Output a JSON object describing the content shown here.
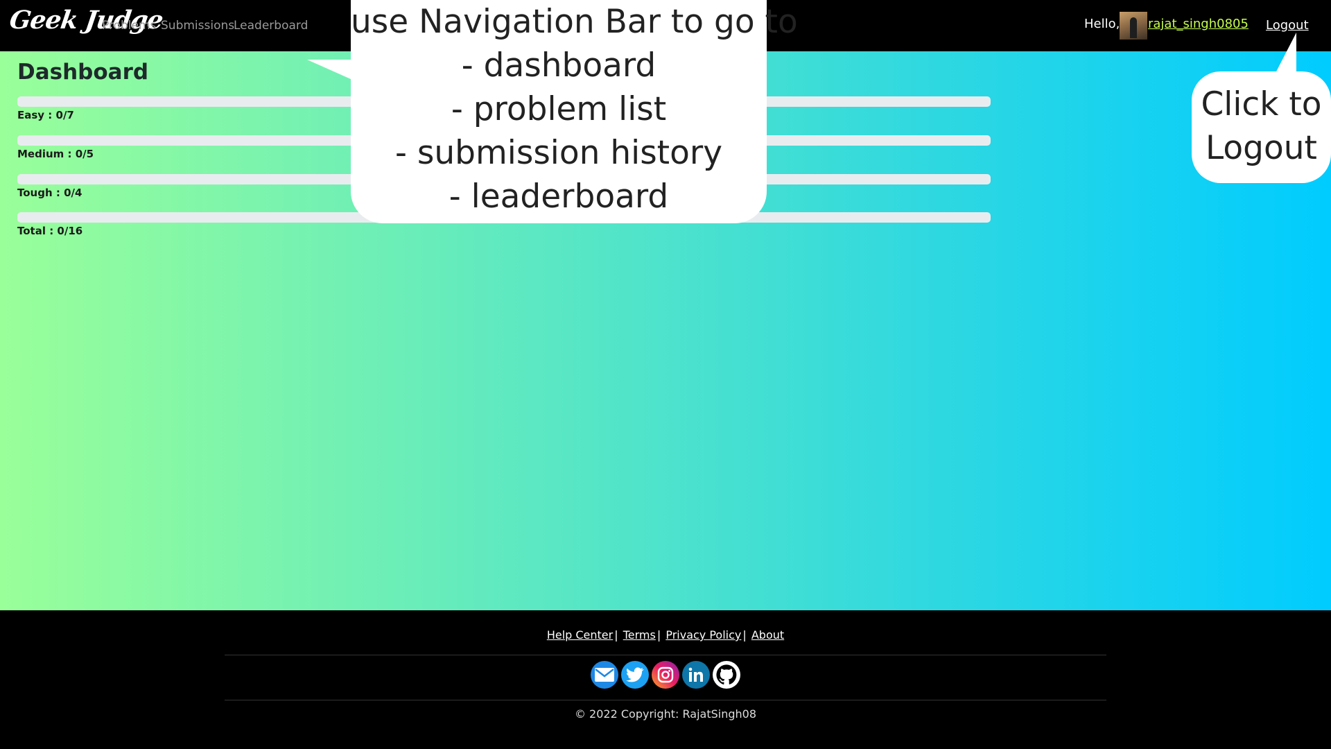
{
  "navbar": {
    "brand": "Geek Judge",
    "links": [
      "Problems",
      "Submissions",
      "Leaderboard"
    ],
    "greeting": "Hello,",
    "username": "rajat_singh0805",
    "logout_label": "Logout"
  },
  "dashboard": {
    "title": "Dashboard",
    "progress": [
      {
        "label": "Easy : 0/7",
        "solved": 0,
        "total": 7
      },
      {
        "label": "Medium : 0/5",
        "solved": 0,
        "total": 5
      },
      {
        "label": "Tough : 0/4",
        "solved": 0,
        "total": 4
      },
      {
        "label": "Total : 0/16",
        "solved": 0,
        "total": 16
      }
    ]
  },
  "callouts": {
    "nav_lines": [
      "use Navigation Bar to go to",
      "- dashboard",
      "- problem list",
      "- submission history",
      "- leaderboard"
    ],
    "logout_lines": [
      "Click to",
      "Logout"
    ]
  },
  "footer": {
    "links": [
      "Help Center",
      "Terms",
      "Privacy Policy",
      "About"
    ],
    "socials": [
      "mail-icon",
      "twitter-icon",
      "instagram-icon",
      "linkedin-icon",
      "github-icon"
    ],
    "copyright": "© 2022 Copyright: RajatSingh08"
  }
}
